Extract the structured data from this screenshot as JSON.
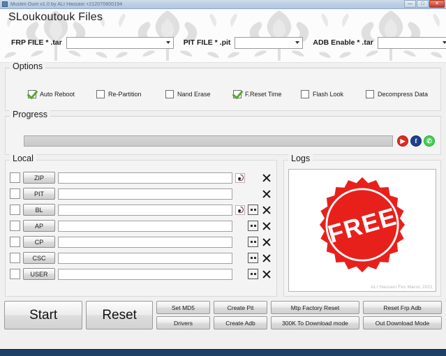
{
  "window": {
    "title": "Muslim Oum v1.0 by ALI Hassani +212070800194",
    "icon": "app-icon",
    "controls": {
      "minimize": "—",
      "maximize": "□",
      "close": "✕"
    }
  },
  "banner": {
    "title": "SLoukoutouk Files",
    "fields": [
      {
        "label": "FRP FILE * .tar",
        "value": "",
        "placeholder": ""
      },
      {
        "label": "PIT FILE * .pit",
        "value": "",
        "placeholder": ""
      },
      {
        "label": "ADB Enable * .tar",
        "value": "",
        "placeholder": ""
      }
    ]
  },
  "options": {
    "title": "Options",
    "items": [
      {
        "label": "Auto Reboot",
        "checked": true
      },
      {
        "label": "Re-Partition",
        "checked": false
      },
      {
        "label": "Nand Erase",
        "checked": false
      },
      {
        "label": "F.Reset Time",
        "checked": true
      },
      {
        "label": "Flash Look",
        "checked": false
      },
      {
        "label": "Decompress Data",
        "checked": false
      }
    ],
    "check_color": "#5aa832"
  },
  "progress": {
    "title": "Progress",
    "percent": 0,
    "social": [
      {
        "name": "youtube-icon",
        "glyph": "▶",
        "color": "#e02a20"
      },
      {
        "name": "facebook-icon",
        "glyph": "f",
        "color": "#1d3f8f"
      },
      {
        "name": "whatsapp-icon",
        "glyph": "✆",
        "color": "#3fd34f"
      }
    ]
  },
  "local": {
    "title": "Local",
    "rows": [
      {
        "label": "ZIP",
        "checked": false,
        "value": "",
        "spinner": true,
        "browse": false
      },
      {
        "label": "PIT",
        "checked": false,
        "value": "",
        "spinner": false,
        "browse": false
      },
      {
        "label": "BL",
        "checked": false,
        "value": "",
        "spinner": true,
        "browse": true
      },
      {
        "label": "AP",
        "checked": false,
        "value": "",
        "spinner": false,
        "browse": true
      },
      {
        "label": "CP",
        "checked": false,
        "value": "",
        "spinner": false,
        "browse": true
      },
      {
        "label": "CSC",
        "checked": false,
        "value": "",
        "spinner": false,
        "browse": true
      },
      {
        "label": "USER",
        "checked": false,
        "value": "",
        "spinner": false,
        "browse": true
      }
    ]
  },
  "logs": {
    "title": "Logs",
    "badge_text": "FREE",
    "badge_color": "#e8201c",
    "watermark": "ALI Hassani Fes Maroc 2021",
    "content": ""
  },
  "actions": {
    "start": "Start",
    "reset": "Reset",
    "set_md5": "Set MD5",
    "drivers": "Drivers",
    "create_pit": "Create Pit",
    "create_adb": "Create Adb",
    "mtp_factory_reset": "Mtp Factory Reset",
    "to_download_mode": "300K To Download mode",
    "reset_frp_adb": "Reset Frp Adb",
    "out_download_mode": "Out Download Mode"
  }
}
